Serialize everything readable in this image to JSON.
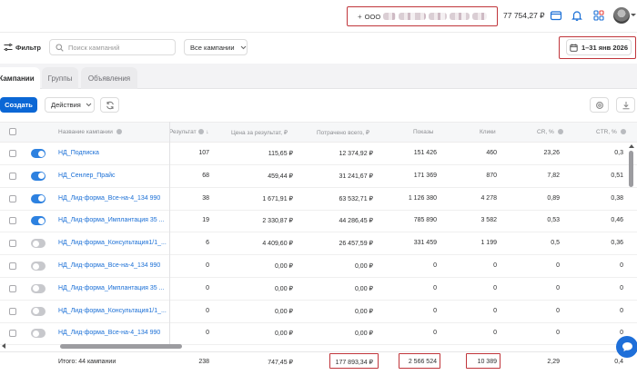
{
  "topbar": {
    "account_label": "ООО",
    "balance": "77 754,27 ₽",
    "icons": [
      "wallet-icon",
      "bell-icon",
      "apps-grid-icon",
      "avatar"
    ]
  },
  "filter": {
    "filter_label": "Фильтр",
    "search_placeholder": "Поиск кампаний",
    "status_select": "Все кампании",
    "date_range": "1–31 янв 2026"
  },
  "tabs": [
    {
      "label": "Кампании",
      "active": true
    },
    {
      "label": "Группы",
      "active": false
    },
    {
      "label": "Объявления",
      "active": false
    }
  ],
  "actions": {
    "create_label": "Создать",
    "actions_label": "Действия"
  },
  "table": {
    "columns": {
      "name": "Название кампании",
      "result": "Результат",
      "cost_per_result": "Цена за результат, ₽",
      "spent": "Потрачено всего, ₽",
      "impressions": "Показы",
      "clicks": "Клики",
      "cr": "CR, %",
      "ctr": "CTR, %"
    },
    "rows": [
      {
        "enabled": true,
        "name": "НД_Подписка",
        "result": "107",
        "cpr": "115,65 ₽",
        "spent": "12 374,92 ₽",
        "impressions": "151 426",
        "clicks": "460",
        "cr": "23,26",
        "ctr": "0,3"
      },
      {
        "enabled": true,
        "name": "НД_Сенлер_Прайс",
        "result": "68",
        "cpr": "459,44 ₽",
        "spent": "31 241,67 ₽",
        "impressions": "171 369",
        "clicks": "870",
        "cr": "7,82",
        "ctr": "0,51"
      },
      {
        "enabled": true,
        "name": "НД_Лид-форма_Все-на-4_134 990",
        "result": "38",
        "cpr": "1 671,91 ₽",
        "spent": "63 532,71 ₽",
        "impressions": "1 126 380",
        "clicks": "4 278",
        "cr": "0,89",
        "ctr": "0,38"
      },
      {
        "enabled": true,
        "name": "НД_Лид-форма_Имплантация 35 ...",
        "result": "19",
        "cpr": "2 330,87 ₽",
        "spent": "44 286,45 ₽",
        "impressions": "785 890",
        "clicks": "3 582",
        "cr": "0,53",
        "ctr": "0,46"
      },
      {
        "enabled": false,
        "name": "НД_Лид-форма_Консультация1/1_...",
        "result": "6",
        "cpr": "4 409,60 ₽",
        "spent": "26 457,59 ₽",
        "impressions": "331 459",
        "clicks": "1 199",
        "cr": "0,5",
        "ctr": "0,36"
      },
      {
        "enabled": false,
        "name": "НД_Лид-форма_Все-на-4_134 990",
        "result": "0",
        "cpr": "0,00 ₽",
        "spent": "0,00 ₽",
        "impressions": "0",
        "clicks": "0",
        "cr": "0",
        "ctr": "0"
      },
      {
        "enabled": false,
        "name": "НД_Лид-форма_Имплантация 35 ...",
        "result": "0",
        "cpr": "0,00 ₽",
        "spent": "0,00 ₽",
        "impressions": "0",
        "clicks": "0",
        "cr": "0",
        "ctr": "0"
      },
      {
        "enabled": false,
        "name": "НД_Лид-форма_Консультация1/1_...",
        "result": "0",
        "cpr": "0,00 ₽",
        "spent": "0,00 ₽",
        "impressions": "0",
        "clicks": "0",
        "cr": "0",
        "ctr": "0"
      },
      {
        "enabled": false,
        "name": "НД_Лид-форма_Все-на-4_134 990",
        "result": "0",
        "cpr": "0,00 ₽",
        "spent": "0,00 ₽",
        "impressions": "0",
        "clicks": "0",
        "cr": "0",
        "ctr": "0"
      }
    ],
    "totals": {
      "label": "Итого: 44 кампании",
      "result": "238",
      "cpr": "747,45 ₽",
      "spent": "177 893,34 ₽",
      "impressions": "2 566 524",
      "clicks": "10 389",
      "cr": "2,29",
      "ctr": "0,4"
    }
  },
  "colors": {
    "primary": "#0b67d5",
    "link": "#1a6fd6",
    "highlight_frame": "#c0353b",
    "toggle_on": "#2d81e0",
    "toggle_off": "#c7c8cc"
  }
}
